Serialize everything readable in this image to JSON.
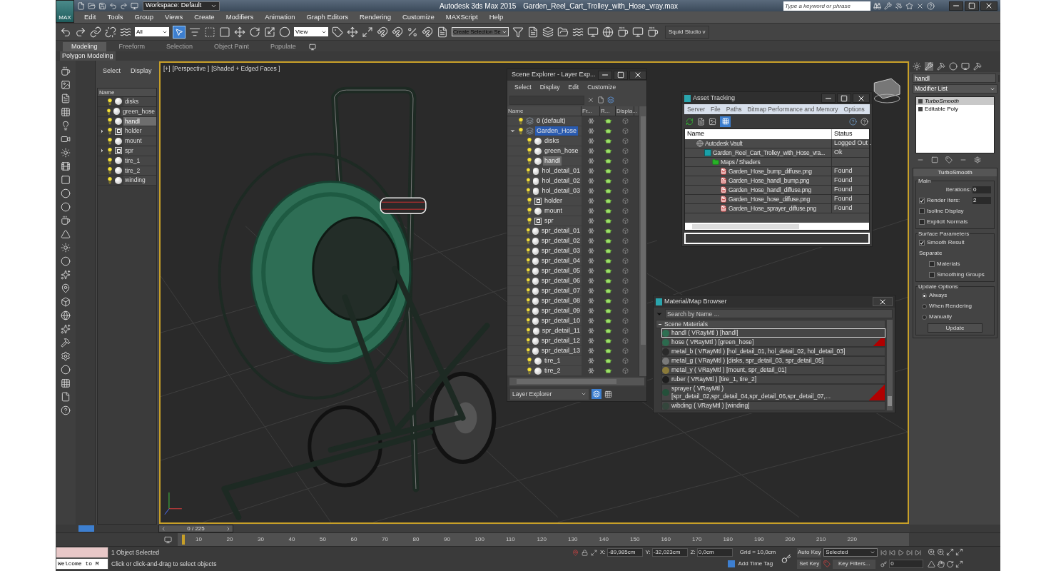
{
  "title_bar": {
    "app_button": "MAX",
    "workspace": "Workspace: Default",
    "title": "Autodesk 3ds Max  2015",
    "file": "Garden_Reel_Cart_Trolley_with_Hose_vray.max",
    "search_placeholder": "Type a keyword or phrase"
  },
  "menu": [
    "Edit",
    "Tools",
    "Group",
    "Views",
    "Create",
    "Modifiers",
    "Animation",
    "Graph Editors",
    "Rendering",
    "Customize",
    "MAXScript",
    "Help"
  ],
  "toolbar": {
    "selection_filter": "All",
    "coord_system": "View",
    "named_selection": "Create Selection Se",
    "studio": "Squid Studio v"
  },
  "ribbon_tabs": [
    {
      "label": "Modeling",
      "selected": true
    },
    {
      "label": "Freeform",
      "selected": false
    },
    {
      "label": "Selection",
      "selected": false
    },
    {
      "label": "Object Paint",
      "selected": false
    },
    {
      "label": "Populate",
      "selected": false
    }
  ],
  "ribbon_panel": "Polygon Modeling",
  "left_explorer": {
    "tabs": [
      "Select",
      "Display"
    ],
    "column": "Name",
    "items": [
      {
        "name": "disks",
        "kind": "object",
        "expandable": false,
        "selected": false
      },
      {
        "name": "green_hose",
        "kind": "object",
        "expandable": false,
        "selected": false
      },
      {
        "name": "handl",
        "kind": "object",
        "expandable": false,
        "selected": true
      },
      {
        "name": "holder",
        "kind": "group",
        "expandable": true,
        "selected": false
      },
      {
        "name": "mount",
        "kind": "object",
        "expandable": false,
        "selected": false
      },
      {
        "name": "spr",
        "kind": "group",
        "expandable": true,
        "selected": false
      },
      {
        "name": "tire_1",
        "kind": "object",
        "expandable": false,
        "selected": false
      },
      {
        "name": "tire_2",
        "kind": "object",
        "expandable": false,
        "selected": false
      },
      {
        "name": "winding",
        "kind": "object",
        "expandable": false,
        "selected": false
      }
    ]
  },
  "viewport": {
    "labels": [
      "[+]",
      "[Perspective ]",
      "[Shaded + Edged Faces ]"
    ]
  },
  "scene_explorer": {
    "title": "Scene Explorer - Layer Exp...",
    "menu": [
      "Select",
      "Display",
      "Edit",
      "Customize"
    ],
    "columns": [
      "Name",
      "Fr...",
      "R...",
      "Displa..."
    ],
    "footer": "Layer Explorer",
    "rows": [
      {
        "name": "0 (default)",
        "kind": "layer",
        "expanded": false,
        "selected": false
      },
      {
        "name": "Garden_Hose",
        "kind": "layer",
        "expanded": true,
        "selected": true,
        "children": [
          {
            "name": "disks",
            "kind": "object",
            "selected": false
          },
          {
            "name": "green_hose",
            "kind": "object",
            "selected": false
          },
          {
            "name": "handl",
            "kind": "object",
            "selected": true
          },
          {
            "name": "hol_detail_01",
            "kind": "object",
            "selected": false
          },
          {
            "name": "hol_detail_02",
            "kind": "object",
            "selected": false
          },
          {
            "name": "hol_detail_03",
            "kind": "object",
            "selected": false
          },
          {
            "name": "holder",
            "kind": "group",
            "selected": false
          },
          {
            "name": "mount",
            "kind": "object",
            "selected": false
          },
          {
            "name": "spr",
            "kind": "group",
            "selected": false
          },
          {
            "name": "spr_detail_01",
            "kind": "object",
            "selected": false
          },
          {
            "name": "spr_detail_02",
            "kind": "object",
            "selected": false
          },
          {
            "name": "spr_detail_03",
            "kind": "object",
            "selected": false
          },
          {
            "name": "spr_detail_04",
            "kind": "object",
            "selected": false
          },
          {
            "name": "spr_detail_05",
            "kind": "object",
            "selected": false
          },
          {
            "name": "spr_detail_06",
            "kind": "object",
            "selected": false
          },
          {
            "name": "spr_detail_07",
            "kind": "object",
            "selected": false
          },
          {
            "name": "spr_detail_08",
            "kind": "object",
            "selected": false
          },
          {
            "name": "spr_detail_09",
            "kind": "object",
            "selected": false
          },
          {
            "name": "spr_detail_10",
            "kind": "object",
            "selected": false
          },
          {
            "name": "spr_detail_11",
            "kind": "object",
            "selected": false
          },
          {
            "name": "spr_detail_12",
            "kind": "object",
            "selected": false
          },
          {
            "name": "spr_detail_13",
            "kind": "object",
            "selected": false
          },
          {
            "name": "tire_1",
            "kind": "object",
            "selected": false
          },
          {
            "name": "tire_2",
            "kind": "object",
            "selected": false
          }
        ]
      }
    ]
  },
  "asset_tracking": {
    "title": "Asset Tracking",
    "menu": [
      "Server",
      "File",
      "Paths",
      "Bitmap Performance and Memory",
      "Options"
    ],
    "columns": [
      "Name",
      "Status"
    ],
    "rows": [
      {
        "name": "Autodesk Vault",
        "kind": "vault",
        "status": "Logged Out .",
        "children": [
          {
            "name": "Garden_Reel_Cart_Trolley_with_Hose_vra...",
            "kind": "scene",
            "status": "Ok",
            "children": [
              {
                "name": "Maps / Shaders",
                "kind": "folder",
                "children": [
                  {
                    "name": "Garden_Hose_bump_diffuse.png",
                    "kind": "image",
                    "status": "Found"
                  },
                  {
                    "name": "Garden_Hose_handl_bump.png",
                    "kind": "image",
                    "status": "Found"
                  },
                  {
                    "name": "Garden_Hose_handl_diffuse.png",
                    "kind": "image",
                    "status": "Found"
                  },
                  {
                    "name": "Garden_Hose_hose_diffuse.png",
                    "kind": "image",
                    "status": "Found"
                  },
                  {
                    "name": "Garden_Hose_sprayer_diffuse.png",
                    "kind": "image",
                    "status": "Found"
                  }
                ]
              }
            ]
          }
        ]
      }
    ]
  },
  "material_browser": {
    "title": "Material/Map Browser",
    "search_placeholder": "Search by Name ...",
    "group": {
      "label": "Scene Materials",
      "expanded": true
    },
    "materials": [
      {
        "label": "handl  ( VRayMtl ) [handl]",
        "color": "#2f6f52",
        "selected": true,
        "flagged": false
      },
      {
        "label": "hose  ( VRayMtl ) [green_hose]",
        "color": "#2c6a4e",
        "selected": false,
        "flagged": true
      },
      {
        "label": "metal_b  ( VRayMtl ) [hol_detail_01, hol_detail_02, hol_detail_03]",
        "color": "#2a2a2a",
        "selected": false,
        "flagged": false
      },
      {
        "label": "metal_g  ( VRayMtl ) [disks, spr_detail_03, spr_detail_05]",
        "color": "#7a7a7a",
        "selected": false,
        "flagged": false
      },
      {
        "label": "metal_y  ( VRayMtl ) [mount, spr_detail_01]",
        "color": "#8a7a3a",
        "selected": false,
        "flagged": false
      },
      {
        "label": "ruber  ( VRayMtl ) [tire_1, tire_2]",
        "color": "#1e1e1e",
        "selected": false,
        "flagged": false
      },
      {
        "label": "sprayer  ( VRayMtl ) [spr_detail_02,spr_detail_04,spr_detail_06,spr_detail_07,...",
        "color": "#24503a",
        "selected": false,
        "flagged": true
      },
      {
        "label": "wibding  ( VRayMtl ) [winding]",
        "color": "#34463c",
        "selected": false,
        "flagged": false
      }
    ]
  },
  "command_panel": {
    "object_name": "handl",
    "modifier_list": "Modifier List",
    "stack": [
      {
        "label": "TurboSmooth",
        "selected": true
      },
      {
        "label": "Editable Poly",
        "selected": false
      }
    ],
    "rollout": {
      "title": "TurboSmooth",
      "main": {
        "label": "Main",
        "iterations": {
          "label": "Iterations:",
          "value": "0"
        },
        "render_iters": {
          "label": "Render Iters:",
          "value": "2",
          "checked": true
        },
        "options": [
          {
            "label": "Isoline Display",
            "checked": false
          },
          {
            "label": "Explicit Normals",
            "checked": false
          }
        ]
      },
      "surface": {
        "label": "Surface Parameters",
        "smooth_result": {
          "label": "Smooth Result",
          "checked": true
        },
        "separate": {
          "label": "Separate",
          "options": [
            {
              "label": "Materials",
              "checked": false
            },
            {
              "label": "Smoothing Groups",
              "checked": false
            }
          ]
        }
      },
      "update": {
        "label": "Update Options",
        "options": [
          {
            "label": "Always",
            "selected": true
          },
          {
            "label": "When Rendering",
            "selected": false
          },
          {
            "label": "Manually",
            "selected": false
          }
        ],
        "button": "Update"
      }
    }
  },
  "timeline": {
    "slider": "0 / 225",
    "level": 0,
    "ticks": [
      "10",
      "20",
      "30",
      "40",
      "50",
      "60",
      "70",
      "80",
      "90",
      "100",
      "110",
      "120",
      "130",
      "140",
      "150",
      "160",
      "170",
      "180",
      "190",
      "200",
      "210",
      "220"
    ]
  },
  "status_bar": {
    "maxscript": "Welcome to M",
    "selection": "1 Object Selected",
    "prompt": "Click or click-and-drag to select objects",
    "coords": [
      {
        "axis": "X:",
        "value": "-89,985cm"
      },
      {
        "axis": "Y:",
        "value": "-32,023cm"
      },
      {
        "axis": "Z:",
        "value": "0,0cm"
      }
    ],
    "grid": "Grid = 10,0cm",
    "add_time_tag": "Add Time Tag",
    "auto_key": "Auto Key",
    "key_mode": "Selected",
    "set_key": "Set Key",
    "key_filters": "Key Filters...",
    "frame": "0"
  }
}
